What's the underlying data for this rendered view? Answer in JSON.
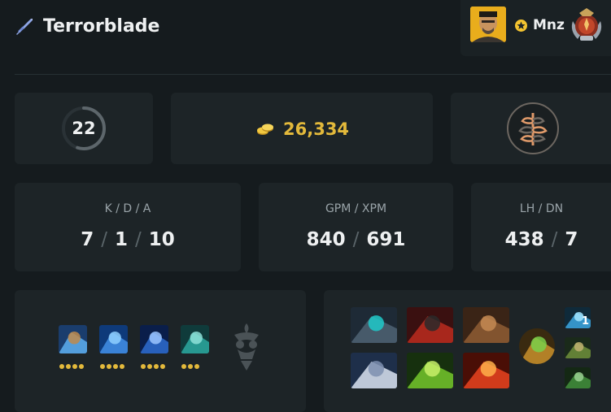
{
  "hero": {
    "name": "Terrorblade",
    "icon": "sword-icon"
  },
  "player": {
    "name": "Mnz",
    "avatar": "player-avatar",
    "badge_icon": "star-icon",
    "rank_icon": "rank-medal-icon"
  },
  "stats": {
    "level": "22",
    "level_progress": 0.55,
    "net_worth": "26,334",
    "gold_icon": "gold-coins-icon",
    "talent_icon": "talent-tree-icon"
  },
  "kda": {
    "title": "K / D / A",
    "kills": "7",
    "deaths": "1",
    "assists": "10",
    "separator": "/"
  },
  "gpm_xpm": {
    "title": "GPM / XPM",
    "gpm": "840",
    "xpm": "691",
    "separator": "/"
  },
  "lh_dn": {
    "title": "LH / DN",
    "last_hits": "438",
    "denies": "7",
    "separator": "/"
  },
  "abilities": [
    {
      "name": "ability-reflection",
      "level": 4,
      "colors": [
        "#1a3d6d",
        "#5aa8e8",
        "#c0894b"
      ]
    },
    {
      "name": "ability-conjure-image",
      "level": 4,
      "colors": [
        "#0e3a7a",
        "#3f8be0",
        "#8fd0ff"
      ]
    },
    {
      "name": "ability-metamorphosis",
      "level": 4,
      "colors": [
        "#0a1e4a",
        "#2b67c8",
        "#9bc6ff"
      ]
    },
    {
      "name": "ability-sunder",
      "level": 3,
      "colors": [
        "#0f3b3b",
        "#2aa39a",
        "#8ee0d8"
      ]
    }
  ],
  "aghanim_icon": "aghanims-shard-icon",
  "items": [
    {
      "name": "item-eye-of-skadi",
      "colors": [
        "#1e2a36",
        "#4b5f70",
        "#20c9c9"
      ]
    },
    {
      "name": "item-sange-and-yasha",
      "colors": [
        "#3a1010",
        "#b52a1e",
        "#2a2a2a"
      ]
    },
    {
      "name": "item-power-treads",
      "colors": [
        "#3a2416",
        "#8b5a32",
        "#c48a52"
      ]
    },
    {
      "name": "item-butterfly",
      "colors": [
        "#1e2f4a",
        "#cfd9e8",
        "#7e8fb0"
      ]
    },
    {
      "name": "item-dragon-lance",
      "colors": [
        "#16300e",
        "#6fbf2a",
        "#c8f06a"
      ]
    },
    {
      "name": "item-daedalus",
      "colors": [
        "#4a0e06",
        "#e0401e",
        "#ffb04a"
      ]
    }
  ],
  "neutral_item": {
    "name": "neutral-item",
    "colors": [
      "#3a2a10",
      "#c08a2a",
      "#7ad04a"
    ]
  },
  "backpack": [
    {
      "name": "backpack-item-tp-scroll",
      "charges": "1",
      "colors": [
        "#0f2a3a",
        "#3aa0d8",
        "#a0e4ff"
      ]
    },
    {
      "name": "backpack-item-quelling-blade",
      "charges": "",
      "colors": [
        "#1a2a1a",
        "#6a8a3a",
        "#c0b070"
      ]
    },
    {
      "name": "backpack-item-wraith-band",
      "charges": "",
      "colors": [
        "#142814",
        "#3f8a3a",
        "#9ad090"
      ]
    }
  ]
}
